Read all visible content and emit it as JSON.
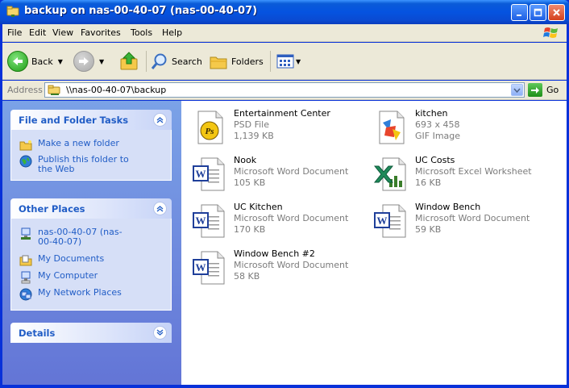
{
  "window": {
    "title": "backup on nas-00-40-07 (nas-00-40-07)"
  },
  "menubar": {
    "items": [
      "File",
      "Edit",
      "View",
      "Favorites",
      "Tools",
      "Help"
    ]
  },
  "toolbar": {
    "back_label": "Back",
    "search_label": "Search",
    "folders_label": "Folders"
  },
  "address": {
    "label": "Address",
    "value": "\\\\nas-00-40-07\\backup",
    "go_label": "Go"
  },
  "taskpane": {
    "file_tasks": {
      "title": "File and Folder Tasks",
      "items": [
        "Make a new folder",
        "Publish this folder to the Web"
      ]
    },
    "other_places": {
      "title": "Other Places",
      "items": [
        "nas-00-40-07 (nas-00-40-07)",
        "My Documents",
        "My Computer",
        "My Network Places"
      ]
    },
    "details": {
      "title": "Details"
    }
  },
  "files": [
    {
      "name": "Entertainment Center",
      "type": "PSD File",
      "size": "1,139 KB",
      "icon": "psd-file-icon"
    },
    {
      "name": "kitchen",
      "type": "693 x 458",
      "size": "GIF Image",
      "icon": "gif-image-icon"
    },
    {
      "name": "Nook",
      "type": "Microsoft Word Document",
      "size": "105 KB",
      "icon": "word-document-icon"
    },
    {
      "name": "UC Costs",
      "type": "Microsoft Excel Worksheet",
      "size": "16 KB",
      "icon": "excel-worksheet-icon"
    },
    {
      "name": "UC Kitchen",
      "type": "Microsoft Word Document",
      "size": "170 KB",
      "icon": "word-document-icon"
    },
    {
      "name": "Window Bench",
      "type": "Microsoft Word Document",
      "size": "59 KB",
      "icon": "word-document-icon"
    },
    {
      "name": "Window Bench #2",
      "type": "Microsoft Word Document",
      "size": "58 KB",
      "icon": "word-document-icon"
    }
  ],
  "colors": {
    "titlebar_blue": "#0a5bd8",
    "link_blue": "#215dc6",
    "chrome": "#ece9d8"
  }
}
